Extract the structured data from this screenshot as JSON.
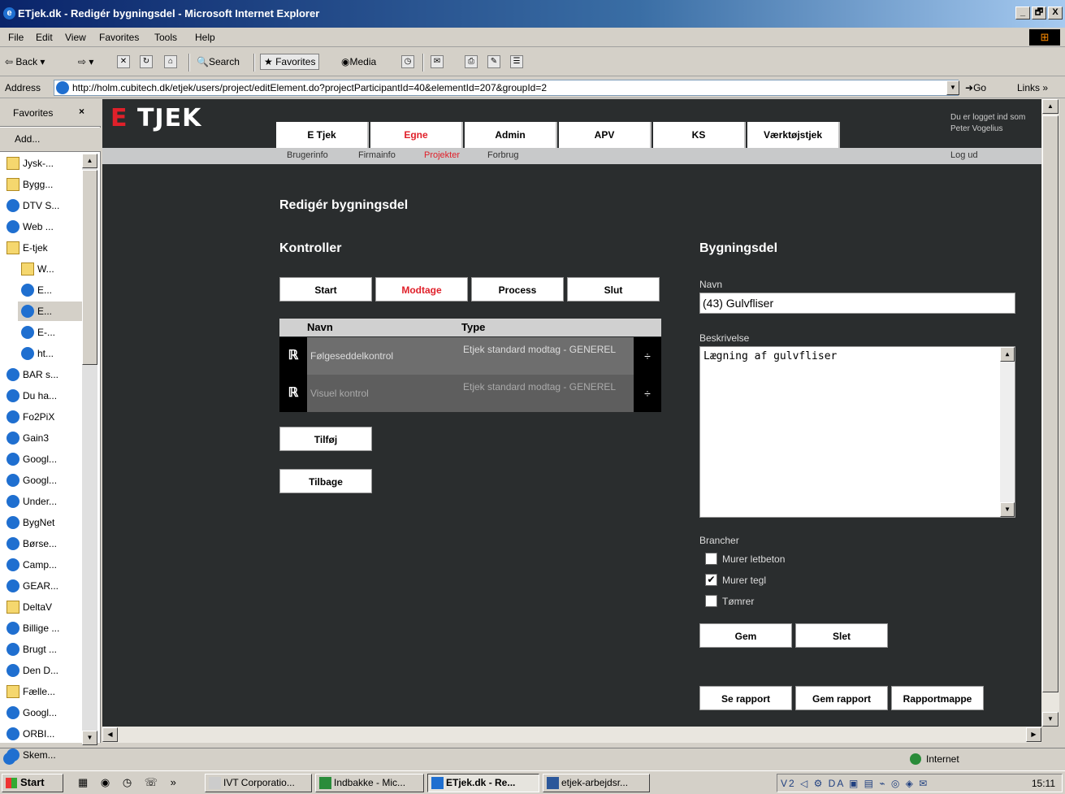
{
  "window": {
    "title": "ETjek.dk - Redigér bygningsdel - Microsoft Internet Explorer",
    "controls": [
      "_",
      "🗗",
      "X"
    ]
  },
  "menu": [
    "File",
    "Edit",
    "View",
    "Favorites",
    "Tools",
    "Help"
  ],
  "toolbar": {
    "back": "Back",
    "search": "Search",
    "favorites": "Favorites",
    "media": "Media"
  },
  "address": {
    "label": "Address",
    "url": "http://holm.cubitech.dk/etjek/users/project/editElement.do?projectParticipantId=40&elementId=207&groupId=2",
    "go": "Go",
    "links": "Links"
  },
  "favorites": {
    "title": "Favorites",
    "close": "×",
    "add": "Add...",
    "items": [
      {
        "label": "Jysk-...",
        "type": "folder"
      },
      {
        "label": "Bygg...",
        "type": "folder"
      },
      {
        "label": "DTV S...",
        "type": "ie"
      },
      {
        "label": "Web ...",
        "type": "ie"
      },
      {
        "label": "E-tjek",
        "type": "folder"
      },
      {
        "label": "W...",
        "type": "folder"
      },
      {
        "label": "E...",
        "type": "ie"
      },
      {
        "label": "E...",
        "type": "ie"
      },
      {
        "label": "E-...",
        "type": "ie"
      },
      {
        "label": "ht...",
        "type": "ie"
      },
      {
        "label": "BAR s...",
        "type": "ie"
      },
      {
        "label": "Du ha...",
        "type": "ie"
      },
      {
        "label": "Fo2PiX",
        "type": "ie"
      },
      {
        "label": "Gain3",
        "type": "ie"
      },
      {
        "label": "Googl...",
        "type": "ie"
      },
      {
        "label": "Googl...",
        "type": "ie"
      },
      {
        "label": "Under...",
        "type": "ie"
      },
      {
        "label": "BygNet",
        "type": "ie"
      },
      {
        "label": "Børse...",
        "type": "ie"
      },
      {
        "label": "Camp...",
        "type": "ie"
      },
      {
        "label": "GEAR...",
        "type": "ie"
      },
      {
        "label": "DeltaV",
        "type": "folder"
      },
      {
        "label": "Billige ...",
        "type": "ie"
      },
      {
        "label": "Brugt ...",
        "type": "ie"
      },
      {
        "label": "Den D...",
        "type": "ie"
      },
      {
        "label": "Fælle...",
        "type": "folder"
      },
      {
        "label": "Googl...",
        "type": "ie"
      },
      {
        "label": "ORBI...",
        "type": "ie"
      },
      {
        "label": "Skem...",
        "type": "ie"
      }
    ]
  },
  "site": {
    "logo_e": "E",
    "logo_rest": " TJEK",
    "logged_in": "Du er logget ind som Peter Vogelius",
    "logout": "Log ud",
    "nav_tabs": [
      "E Tjek",
      "Egne",
      "Admin",
      "APV",
      "KS",
      "Værktøjstjek"
    ],
    "active_tab": "Egne",
    "subnav": [
      "Brugerinfo",
      "Firmainfo",
      "Projekter",
      "Forbrug"
    ],
    "active_sub": "Projekter"
  },
  "page": {
    "title": "Redigér bygningsdel",
    "controls_heading": "Kontroller",
    "phase_buttons": [
      "Start",
      "Modtage",
      "Process",
      "Slut"
    ],
    "active_phase": "Modtage",
    "table_headers": {
      "name": "Navn",
      "type": "Type"
    },
    "rows": [
      {
        "name": "Følgeseddelkontrol",
        "type": "Etjek standard modtag - GENEREL"
      },
      {
        "name": "Visuel kontrol",
        "type": "Etjek standard modtag - GENEREL"
      }
    ],
    "add_button": "Tilføj",
    "back_button": "Tilbage",
    "element_heading": "Bygningsdel",
    "name_label": "Navn",
    "name_value": "(43) Gulvfliser",
    "desc_label": "Beskrivelse",
    "desc_value": "Lægning af gulvfliser",
    "branches_label": "Brancher",
    "branches": [
      {
        "label": "Murer letbeton",
        "checked": false
      },
      {
        "label": "Murer tegl",
        "checked": true
      },
      {
        "label": "Tømrer",
        "checked": false
      }
    ],
    "save_button": "Gem",
    "delete_button": "Slet",
    "report_buttons": [
      "Se rapport",
      "Gem rapport",
      "Rapportmappe"
    ]
  },
  "status": {
    "zone": "Internet"
  },
  "taskbar": {
    "start": "Start",
    "tasks": [
      "IVT Corporatio...",
      "Indbakke - Mic...",
      "ETjek.dk - Re...",
      "etjek-arbejdsr..."
    ],
    "active_task": "ETjek.dk - Re...",
    "clock": "15:11"
  }
}
